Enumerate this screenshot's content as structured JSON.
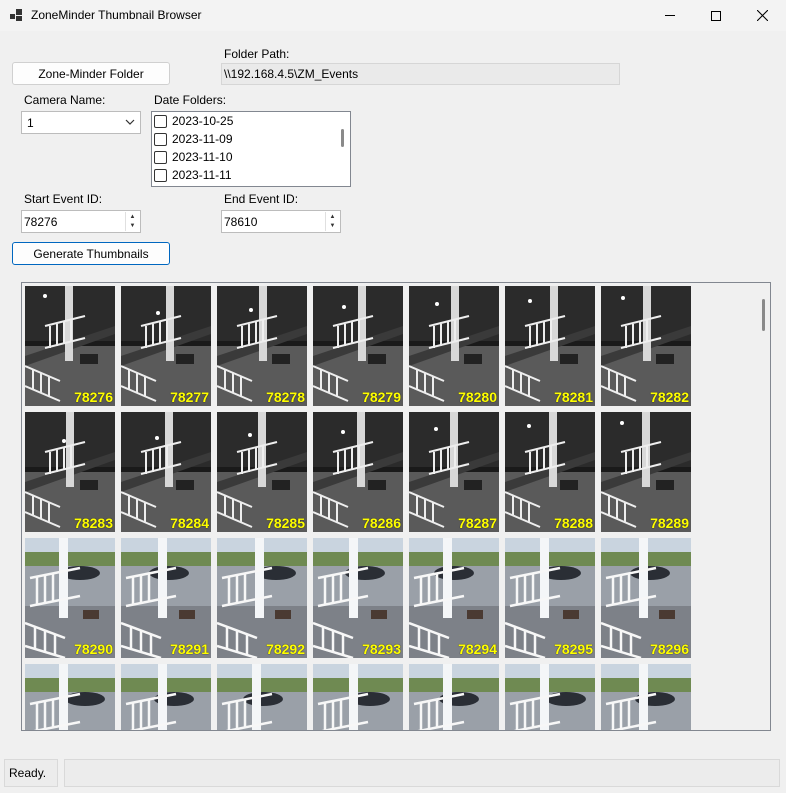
{
  "window": {
    "title": "ZoneMinder Thumbnail Browser"
  },
  "form": {
    "folder_button": "Zone-Minder Folder",
    "folder_path_label": "Folder Path:",
    "folder_path_value": "\\\\192.168.4.5\\ZM_Events",
    "camera_name_label": "Camera Name:",
    "camera_value": "1",
    "date_folders_label": "Date Folders:",
    "date_folders": [
      "2023-10-25",
      "2023-11-09",
      "2023-11-10",
      "2023-11-11"
    ],
    "start_event_label": "Start Event ID:",
    "start_event_value": "78276",
    "end_event_label": "End Event ID:",
    "end_event_value": "78610",
    "generate_button": "Generate Thumbnails"
  },
  "thumbnails": [
    {
      "id": "78276",
      "scene": "night"
    },
    {
      "id": "78277",
      "scene": "night"
    },
    {
      "id": "78278",
      "scene": "night"
    },
    {
      "id": "78279",
      "scene": "night"
    },
    {
      "id": "78280",
      "scene": "night"
    },
    {
      "id": "78281",
      "scene": "night"
    },
    {
      "id": "78282",
      "scene": "night"
    },
    {
      "id": "78283",
      "scene": "night"
    },
    {
      "id": "78284",
      "scene": "night"
    },
    {
      "id": "78285",
      "scene": "night"
    },
    {
      "id": "78286",
      "scene": "night"
    },
    {
      "id": "78287",
      "scene": "night"
    },
    {
      "id": "78288",
      "scene": "night"
    },
    {
      "id": "78289",
      "scene": "night"
    },
    {
      "id": "78290",
      "scene": "day"
    },
    {
      "id": "78291",
      "scene": "day"
    },
    {
      "id": "78292",
      "scene": "day"
    },
    {
      "id": "78293",
      "scene": "day"
    },
    {
      "id": "78294",
      "scene": "day"
    },
    {
      "id": "78295",
      "scene": "day"
    },
    {
      "id": "78296",
      "scene": "day"
    },
    {
      "id": "",
      "scene": "day"
    },
    {
      "id": "",
      "scene": "day"
    },
    {
      "id": "",
      "scene": "day"
    },
    {
      "id": "",
      "scene": "day"
    },
    {
      "id": "",
      "scene": "day"
    },
    {
      "id": "",
      "scene": "day"
    },
    {
      "id": "",
      "scene": "day"
    }
  ],
  "status": {
    "text": "Ready."
  }
}
